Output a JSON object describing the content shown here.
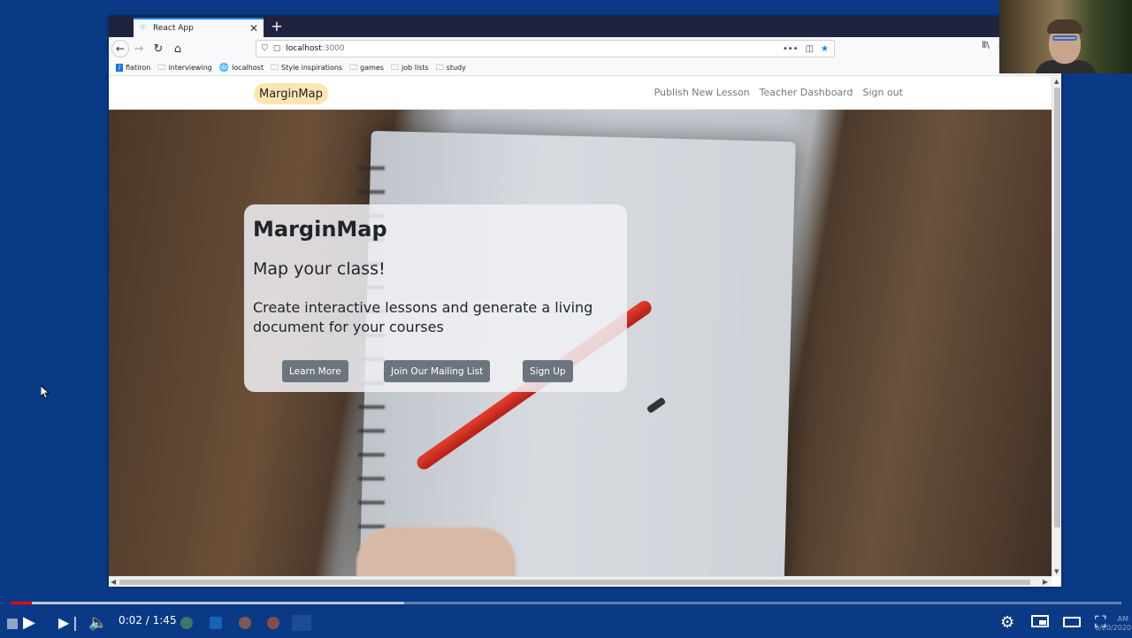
{
  "browser": {
    "tab_title": "React App",
    "tab_icon": "react-icon",
    "new_tab_label": "+",
    "url_host": "localhost",
    "url_port": ":3000",
    "bookmarks": [
      {
        "label": "flatiron",
        "icon": "flatiron-icon"
      },
      {
        "label": "interviewing",
        "icon": "folder-icon"
      },
      {
        "label": "localhost",
        "icon": "globe-icon"
      },
      {
        "label": "Style inspirations",
        "icon": "folder-icon"
      },
      {
        "label": "games",
        "icon": "folder-icon"
      },
      {
        "label": "job lists",
        "icon": "folder-icon"
      },
      {
        "label": "study",
        "icon": "folder-icon"
      }
    ]
  },
  "site": {
    "brand": "MarginMap",
    "nav_links": [
      "Publish New Lesson",
      "Teacher Dashboard",
      "Sign out"
    ]
  },
  "hero": {
    "title": "MarginMap",
    "subtitle": "Map your class!",
    "description": "Create interactive lessons and generate a living document for your courses",
    "buttons": [
      "Learn More",
      "Join Our Mailing List",
      "Sign Up"
    ]
  },
  "player": {
    "current_time": "0:02",
    "separator": " / ",
    "duration": "1:45",
    "played_fraction": 0.019,
    "buffered_fraction": 0.354
  },
  "taskbar": {
    "clock_time": "AM",
    "clock_date": "6/20/2020"
  },
  "colors": {
    "desktop_bg": "#0a3a86",
    "brand_pill": "#fbe6b3",
    "button_bg": "#6c757d",
    "progress_played": "#ff0000"
  }
}
